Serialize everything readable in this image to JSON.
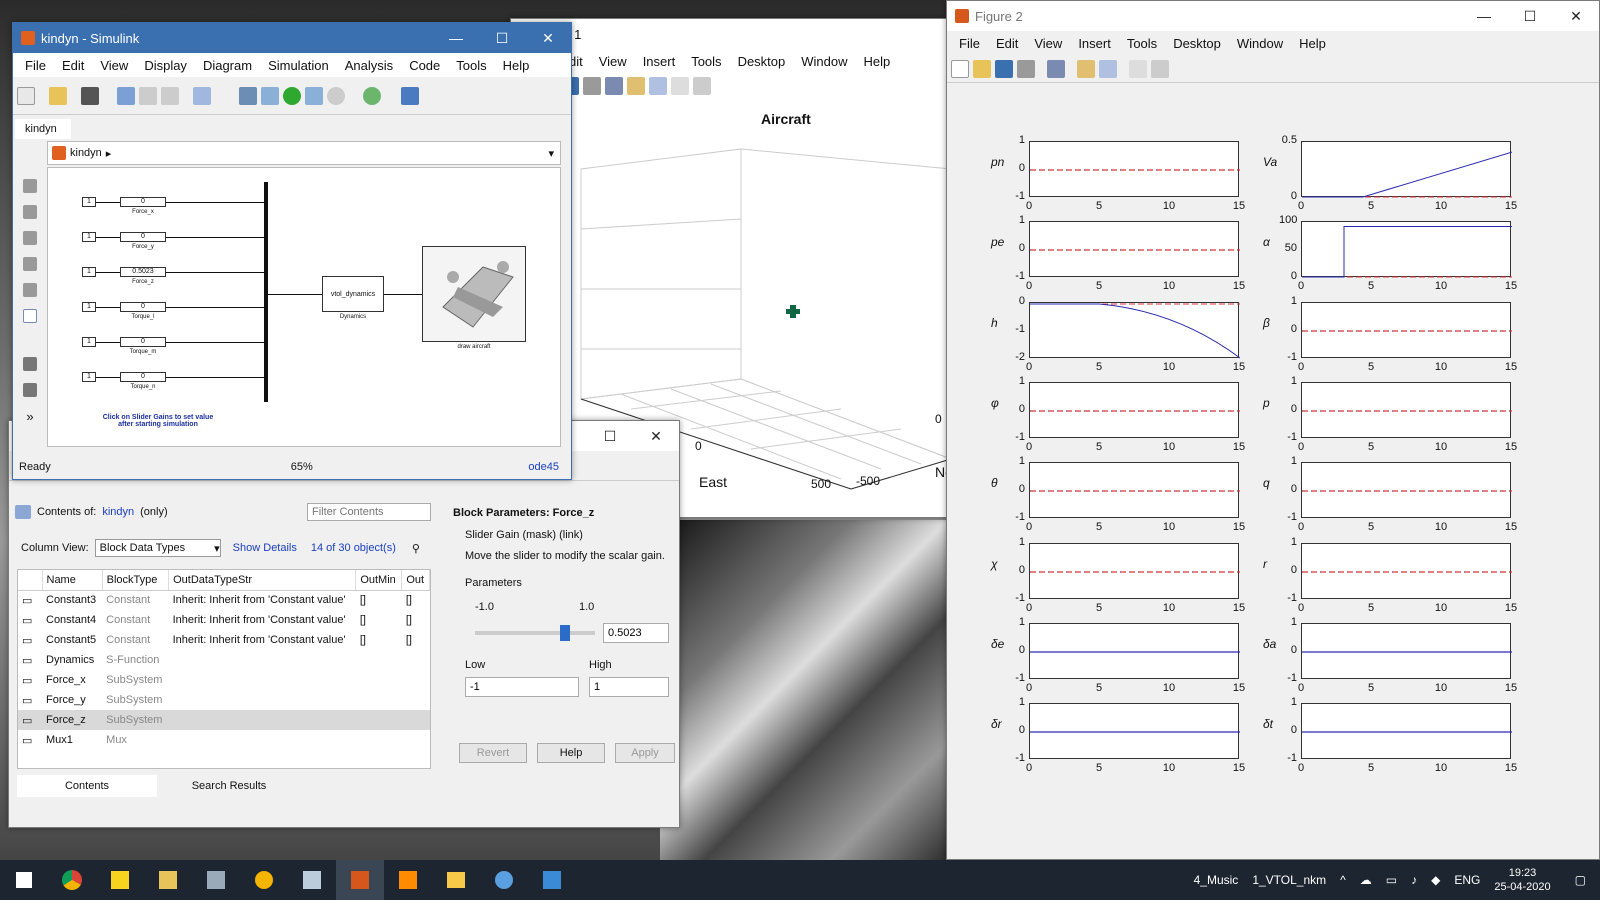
{
  "simulink": {
    "title": "kindyn - Simulink",
    "menu": [
      "File",
      "Edit",
      "View",
      "Display",
      "Diagram",
      "Simulation",
      "Analysis",
      "Code",
      "Tools",
      "Help"
    ],
    "tab": "kindyn",
    "breadcrumb": "kindyn",
    "status_left": "Ready",
    "zoom": "65%",
    "solver": "ode45",
    "note_line1": "Click on Slider Gains to set value",
    "note_line2": "after starting simulation",
    "blocks": [
      {
        "const": "1",
        "gain": "0",
        "label": "Force_x"
      },
      {
        "const": "1",
        "gain": "0",
        "label": "Force_y"
      },
      {
        "const": "1",
        "gain": "0.5023",
        "label": "Force_z"
      },
      {
        "const": "1",
        "gain": "0",
        "label": "Torque_l"
      },
      {
        "const": "1",
        "gain": "0",
        "label": "Torque_m"
      },
      {
        "const": "1",
        "gain": "0",
        "label": "Torque_n"
      }
    ],
    "dyn_block": "vtol_dynamics",
    "dyn_label": "Dynamics",
    "draw_label": "draw aircraft"
  },
  "figure1": {
    "title_partial": "re 1",
    "menu": [
      "dit",
      "View",
      "Insert",
      "Tools",
      "Desktop",
      "Window",
      "Help"
    ],
    "plot_title": "Aircraft",
    "x_axis_label": "East",
    "y_axis_label_partial": "No",
    "ticks": [
      "0",
      "0",
      "0",
      "500",
      "-500",
      "0",
      "0",
      "0"
    ]
  },
  "explorer": {
    "contents_of": "Contents of:",
    "model_link": "kindyn",
    "only": "(only)",
    "filter_placeholder": "Filter Contents",
    "column_view_label": "Column View:",
    "column_view_value": "Block Data Types",
    "show_details": "Show Details",
    "object_count": "14 of 30 object(s)",
    "columns": [
      "Name",
      "BlockType",
      "OutDataTypeStr",
      "OutMin",
      "Out"
    ],
    "rows": [
      {
        "name": "Constant3",
        "type": "Constant",
        "out": "Inherit: Inherit from 'Constant value'",
        "min": "[]",
        "max": "[]"
      },
      {
        "name": "Constant4",
        "type": "Constant",
        "out": "Inherit: Inherit from 'Constant value'",
        "min": "[]",
        "max": "[]"
      },
      {
        "name": "Constant5",
        "type": "Constant",
        "out": "Inherit: Inherit from 'Constant value'",
        "min": "[]",
        "max": "[]"
      },
      {
        "name": "Dynamics",
        "type": "S-Function",
        "out": "",
        "min": "",
        "max": ""
      },
      {
        "name": "Force_x",
        "type": "SubSystem",
        "out": "",
        "min": "",
        "max": ""
      },
      {
        "name": "Force_y",
        "type": "SubSystem",
        "out": "",
        "min": "",
        "max": ""
      },
      {
        "name": "Force_z",
        "type": "SubSystem",
        "out": "",
        "min": "",
        "max": ""
      },
      {
        "name": "Mux1",
        "type": "Mux",
        "out": "",
        "min": "",
        "max": ""
      }
    ],
    "tab_contents": "Contents",
    "tab_search": "Search Results",
    "params_title": "Block Parameters: Force_z",
    "mask_type": "Slider Gain (mask) (link)",
    "mask_desc": "Move the slider to modify the scalar gain.",
    "params_label": "Parameters",
    "slider_min": "-1.0",
    "slider_max": "1.0",
    "slider_value": "0.5023",
    "slider_fraction": 0.75,
    "low_label": "Low",
    "high_label": "High",
    "low_value": "-1",
    "high_value": "1",
    "revert": "Revert",
    "help": "Help",
    "apply": "Apply"
  },
  "figure2": {
    "title": "Figure 2",
    "menu": [
      "File",
      "Edit",
      "View",
      "Insert",
      "Tools",
      "Desktop",
      "Window",
      "Help"
    ],
    "x_ticks": [
      "0",
      "5",
      "10",
      "15"
    ],
    "plots": [
      {
        "label": "pn",
        "yt": [
          "1",
          "0",
          "-1"
        ],
        "kind": "flat"
      },
      {
        "label": "Va",
        "yt": [
          "0.5",
          "",
          "0"
        ],
        "kind": "ramp"
      },
      {
        "label": "pe",
        "yt": [
          "1",
          "0",
          "-1"
        ],
        "kind": "flat"
      },
      {
        "label": "α",
        "yt": [
          "100",
          "50",
          "0"
        ],
        "kind": "step"
      },
      {
        "label": "h",
        "yt": [
          "0",
          "-1",
          "-2"
        ],
        "kind": "curve"
      },
      {
        "label": "β",
        "yt": [
          "1",
          "0",
          "-1"
        ],
        "kind": "flat"
      },
      {
        "label": "φ",
        "yt": [
          "1",
          "0",
          "-1"
        ],
        "kind": "flat"
      },
      {
        "label": "p",
        "yt": [
          "1",
          "0",
          "-1"
        ],
        "kind": "flat"
      },
      {
        "label": "θ",
        "yt": [
          "1",
          "0",
          "-1"
        ],
        "kind": "flat"
      },
      {
        "label": "q",
        "yt": [
          "1",
          "0",
          "-1"
        ],
        "kind": "flat"
      },
      {
        "label": "χ",
        "yt": [
          "1",
          "0",
          "-1"
        ],
        "kind": "flat"
      },
      {
        "label": "r",
        "yt": [
          "1",
          "0",
          "-1"
        ],
        "kind": "flat"
      },
      {
        "label": "δe",
        "yt": [
          "1",
          "0",
          "-1"
        ],
        "kind": "blue"
      },
      {
        "label": "δa",
        "yt": [
          "1",
          "0",
          "-1"
        ],
        "kind": "blue"
      },
      {
        "label": "δr",
        "yt": [
          "1",
          "0",
          "-1"
        ],
        "kind": "blue"
      },
      {
        "label": "δt",
        "yt": [
          "1",
          "0",
          "-1"
        ],
        "kind": "blue"
      }
    ]
  },
  "taskbar": {
    "music": "4_Music",
    "folder": "1_VTOL_nkm",
    "lang": "ENG",
    "time": "19:23",
    "date": "25-04-2020"
  }
}
